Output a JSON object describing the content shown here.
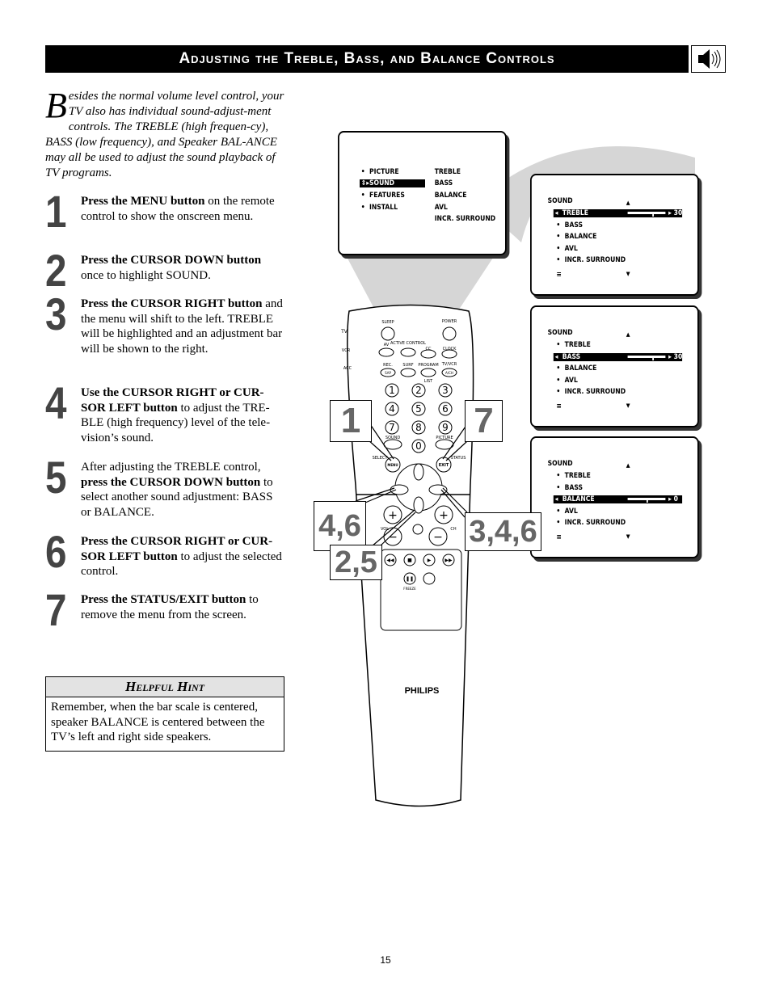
{
  "header": {
    "title": "Adjusting the Treble, Bass, and Balance Controls",
    "icon": "speaker-sound-icon"
  },
  "intro": {
    "drop_cap": "B",
    "text": "esides the normal volume level control, your TV also has individual sound-adjust-ment controls.  The TREBLE (high frequen-cy), BASS (low frequency), and Speaker BAL-ANCE may all be used to adjust the sound playback of TV programs."
  },
  "steps": [
    {
      "number": "1",
      "pre": "",
      "bold": "Press the MENU button",
      "post": " on the remote control to show the onscreen menu."
    },
    {
      "number": "2",
      "pre": "",
      "bold": "Press the CURSOR DOWN button",
      "post": " once to highlight SOUND."
    },
    {
      "number": "3",
      "pre": "",
      "bold": "Press the CURSOR RIGHT button",
      "post": " and the menu will shift to the left. TREBLE will be highlighted and an adjustment bar will be shown to the right."
    },
    {
      "number": "4",
      "pre": "",
      "bold": "Use the CURSOR RIGHT or CUR-SOR LEFT button",
      "post": " to adjust the TRE-BLE (high frequency) level of the tele-vision’s sound."
    },
    {
      "number": "5",
      "pre": "After adjusting the TREBLE control, ",
      "bold": "press the CURSOR DOWN button",
      "post": " to select another sound adjustment: BASS or BALANCE."
    },
    {
      "number": "6",
      "pre": "",
      "bold": "Press the CURSOR RIGHT or CUR-SOR LEFT button",
      "post": " to adjust the selected control."
    },
    {
      "number": "7",
      "pre": "",
      "bold": "Press the STATUS/EXIT button",
      "post": " to remove the menu from the screen."
    }
  ],
  "hint": {
    "title": "Helpful Hint",
    "body": "Remember, when the bar scale is centered, speaker BALANCE is centered between the TV’s left and right side speakers."
  },
  "main_menu": {
    "left": [
      "PICTURE",
      "SOUND",
      "FEATURES",
      "INSTALL"
    ],
    "right": [
      "TREBLE",
      "BASS",
      "BALANCE",
      "AVL",
      "INCR.  SURROUND"
    ],
    "highlighted": "SOUND"
  },
  "sound_screens": [
    {
      "title": "SOUND",
      "items": [
        "TREBLE",
        "BASS",
        "BALANCE",
        "AVL",
        "INCR.  SURROUND"
      ],
      "highlighted": 0,
      "value": "30",
      "level": 30
    },
    {
      "title": "SOUND",
      "items": [
        "TREBLE",
        "BASS",
        "BALANCE",
        "AVL",
        "INCR.  SURROUND"
      ],
      "highlighted": 1,
      "value": "30",
      "level": 30
    },
    {
      "title": "SOUND",
      "items": [
        "TREBLE",
        "BASS",
        "BALANCE",
        "AVL",
        "INCR.  SURROUND"
      ],
      "highlighted": 2,
      "value": "0",
      "level": 0
    }
  ],
  "remote": {
    "mode_labels": [
      "TV",
      "VCR",
      "ACC"
    ],
    "buttons": {
      "sleep": "SLEEP",
      "power": "POWER",
      "av": "AV",
      "active_control": "ACTIVE CONTROL",
      "cc": "CC",
      "clock": "CLOCK",
      "rec": "REC.",
      "sap": "SAP",
      "surf": "SURF",
      "program": "PROGRAM",
      "list": "LIST",
      "tvvcr": "TV/VCR",
      "ach": "A/CH",
      "sound": "SOUND",
      "picture": "PICTURE",
      "select": "SELECT",
      "menu": "MENU",
      "exit": "EXIT",
      "status": "STATUS",
      "vol": "VOL",
      "ch": "CH",
      "freeze": "FREEZE"
    },
    "digits": [
      "1",
      "2",
      "3",
      "4",
      "5",
      "6",
      "7",
      "8",
      "9",
      "0"
    ],
    "brand": "PHILIPS"
  },
  "callouts": {
    "c1": "1",
    "c7": "7",
    "c46": "4,6",
    "c25": "2,5",
    "c346": "3,4,6"
  },
  "page_number": "15"
}
